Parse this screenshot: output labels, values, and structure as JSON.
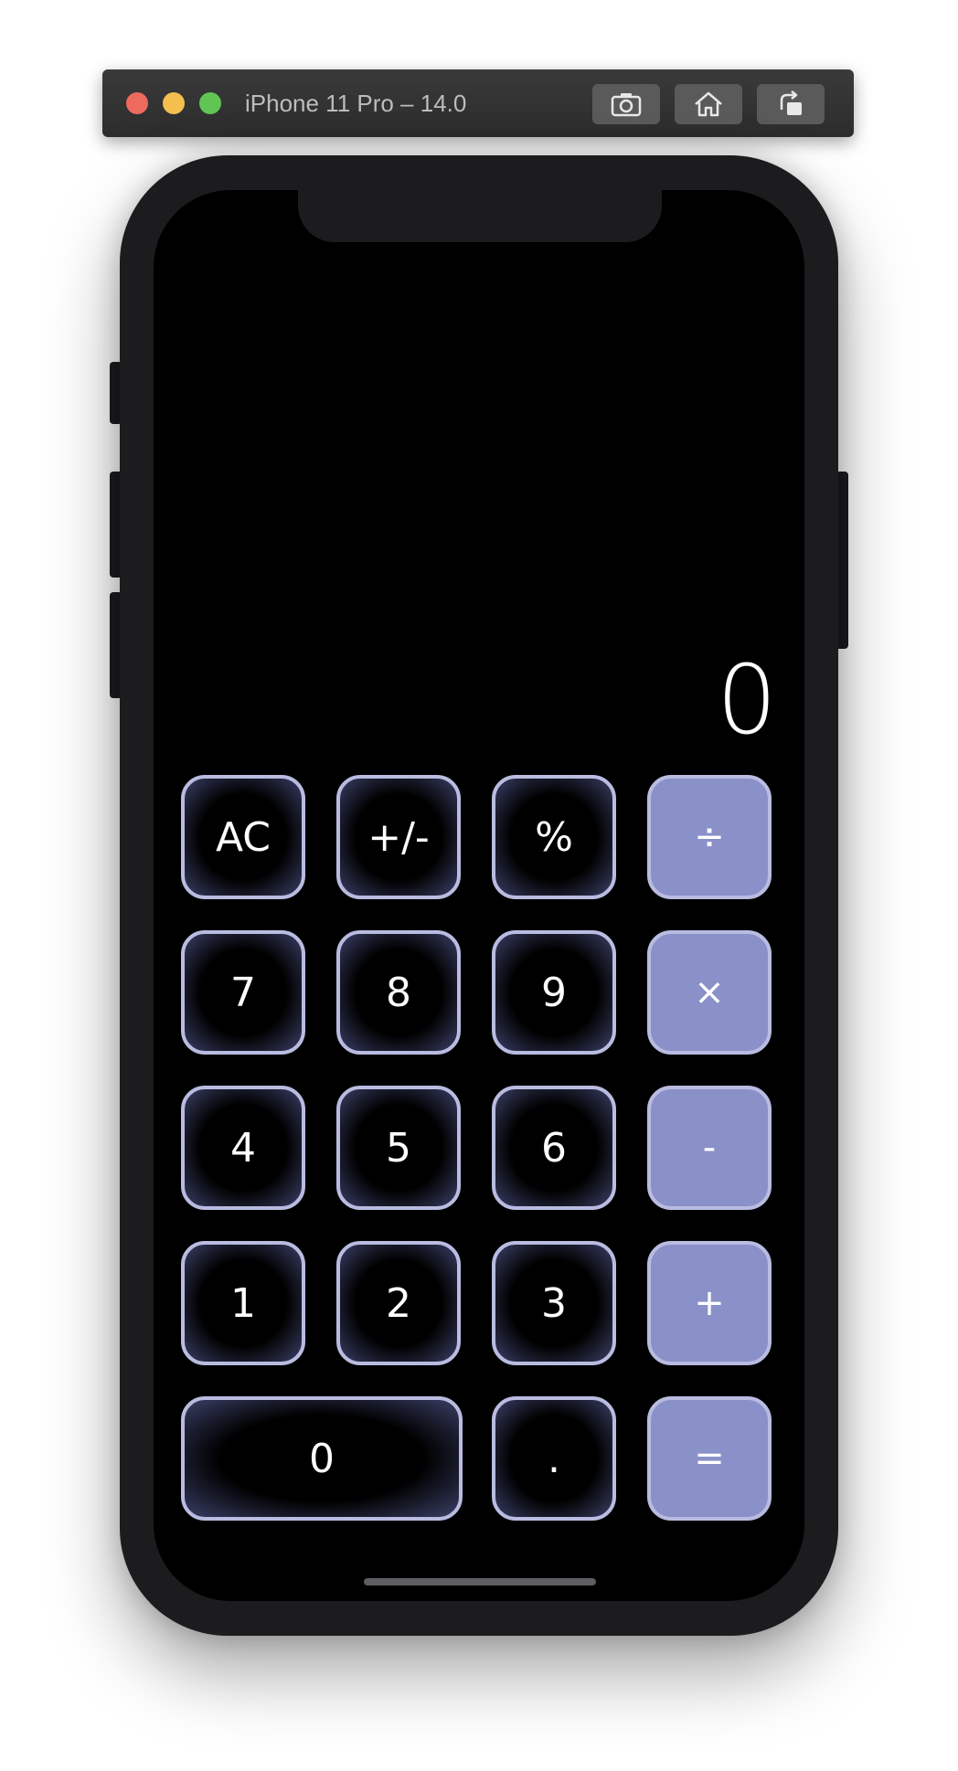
{
  "simulator": {
    "title": "iPhone 11 Pro – 14.0",
    "buttons": [
      "screenshot-icon",
      "home-icon",
      "rotate-icon"
    ]
  },
  "calculator": {
    "display": "0",
    "keys": {
      "ac": "AC",
      "sign": "+/-",
      "percent": "%",
      "divide": "÷",
      "seven": "7",
      "eight": "8",
      "nine": "9",
      "multiply": "×",
      "four": "4",
      "five": "5",
      "six": "6",
      "minus": "-",
      "one": "1",
      "two": "2",
      "three": "3",
      "plus": "+",
      "zero": "0",
      "decimal": ".",
      "equals": "="
    }
  },
  "colors": {
    "operator_key": "#8a90c8",
    "key_border": "#b9bce0",
    "screen_bg": "#000000"
  }
}
